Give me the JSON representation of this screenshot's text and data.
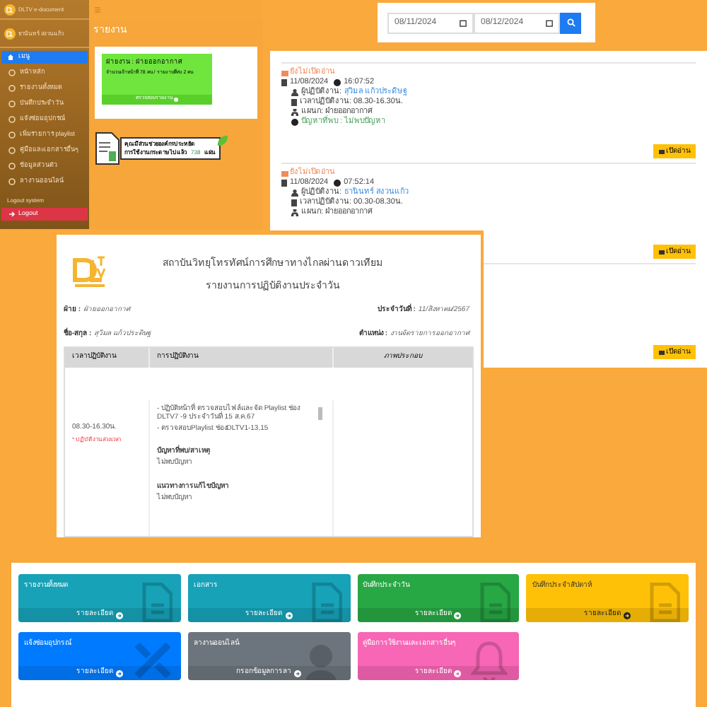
{
  "admin": {
    "brand": "DLTV e-document",
    "user": "ธานินทร์ สงวนแก้ว",
    "menu": [
      {
        "label": "เมนู",
        "selected": true
      },
      {
        "label": "หน้าหลัก",
        "selected": false
      },
      {
        "label": "รายงานทั้งหมด",
        "selected": false
      },
      {
        "label": "บันทึกประจำวัน",
        "selected": false
      },
      {
        "label": "แจ้งซ่อมอุปกรณ์",
        "selected": false
      },
      {
        "label": "เพิ่มรายการ playlist",
        "selected": false
      },
      {
        "label": "คู่มือและเอกสารอื่นๆ",
        "selected": false
      },
      {
        "label": "ข้อมูลส่วนตัว",
        "selected": false
      },
      {
        "label": "ลางานออนไลน์",
        "selected": false
      }
    ],
    "logout_heading": "Logout system",
    "logout": "Logout",
    "page_title": "รายงาน",
    "department_card": {
      "title": "ฝ่ายงาน : ฝ่ายออกอากาศ",
      "detail": "จำนวนเจ้าหน้าที่ 78 คน / รายงานที่ส่ง 2 คน",
      "link": "ตรวจสอบรายงาน"
    },
    "paper_banner": {
      "line1": "คุณมีส่วนช่วยองค์กรประหยัด",
      "line2": "การใช้งานกระดาษไปแล้ว",
      "count": "738",
      "unit": "แผ่น"
    }
  },
  "search": {
    "date_from": "08/11/2024",
    "date_to": "08/12/2024"
  },
  "notifications": [
    {
      "status": "ยังไม่เปิดอ่าน",
      "date": "11/08/2024",
      "time": "16:07:52",
      "worker_label": "ผู้ปฏิบัติงาน:",
      "worker": "สุวิมล แก้วประดิษฐ",
      "shift": "เวลาปฏิบัติงาน: 08.30-16.30น.",
      "department": "แผนก: ฝ่ายออกอากาศ",
      "problem": "ปัญหาที่พบ : ไม่พบปัญหา",
      "button": "เปิดอ่าน"
    },
    {
      "status": "ยังไม่เปิดอ่าน",
      "date": "11/08/2024",
      "time": "07:52:14",
      "worker_label": "ผู้ปฏิบัติงาน:",
      "worker": "ธานินทร์ สงวนแก้ว",
      "shift": "เวลาปฏิบัติงาน: 00.30-08.30น.",
      "department": "แผนก: ฝ่ายออกอากาศ",
      "button": "เปิดอ่าน"
    },
    {
      "button": "เปิดอ่าน"
    }
  ],
  "report": {
    "institute": "สถาบันวิทยุโทรทัศน์การศึกษาทางไกลผ่านดาวเทียม",
    "title": "รายงานการปฏิบัติงานประจำวัน",
    "fields": [
      {
        "label": "ฝ่าย :",
        "value": "ฝ่ายออกอากาศ"
      },
      {
        "label": "ประจำวันที่ :",
        "value": "11/สิงหาคม/2567"
      },
      {
        "label": "ชื่อ-สกุล :",
        "value": "สุวิมล แก้วประดิษฐ"
      },
      {
        "label": "ตำแหน่ง :",
        "value": "งานจัดรายการออกอากาศ"
      }
    ],
    "columns": [
      "เวลาปฏิบัติงาน",
      "การปฏิบัติงาน",
      "ภาพประกอบ"
    ],
    "time": "08.30-16.30น.",
    "overtime": "* ปฏิบัติงานล่วงเวลา",
    "work": [
      "- ปฏิบัติหน้าที่ ตรวจสอบไฟล์และจัด Playlist ช่อง DLTV7 -9 ประจำวันที่ 15 ส.ค.67",
      "- ตรวจสอบPlaylist ช่องDLTV1-13,15"
    ],
    "sections": [
      {
        "heading": "ปัญหาที่พบ/สาเหตุ",
        "text": "ไม่พบปัญหา"
      },
      {
        "heading": "แนวทางการแก้ไขปัญหา",
        "text": "ไม่พบปัญหา"
      }
    ]
  },
  "tiles": [
    {
      "title": "รายงานทั้งหมด",
      "link": "รายละเอียด",
      "color": "#17a2b8",
      "kind": "document"
    },
    {
      "title": "เอกสาร",
      "link": "รายละเอียด",
      "color": "#17a2b8",
      "kind": "document"
    },
    {
      "title": "บันทึกประจำวัน",
      "link": "รายละเอียด",
      "color": "#28a745",
      "kind": "document"
    },
    {
      "title": "บันทึกประจำสัปดาห์",
      "link": "รายละเอียด",
      "color": "#ffc107",
      "kind": "document"
    },
    {
      "title": "แจ้งซ่อมอุปกรณ์",
      "link": "รายละเอียด",
      "color": "#007bff",
      "kind": "tools"
    },
    {
      "title": "ลางานออนไลน์",
      "link": "กรอกข้อมูลการลา",
      "color": "#6c757d",
      "kind": "person"
    },
    {
      "title": "คู่มือการใช้งานและเอกสารอื่นๆ",
      "link": "รายละเอียด",
      "color": "#f866b6",
      "kind": "bell"
    }
  ]
}
